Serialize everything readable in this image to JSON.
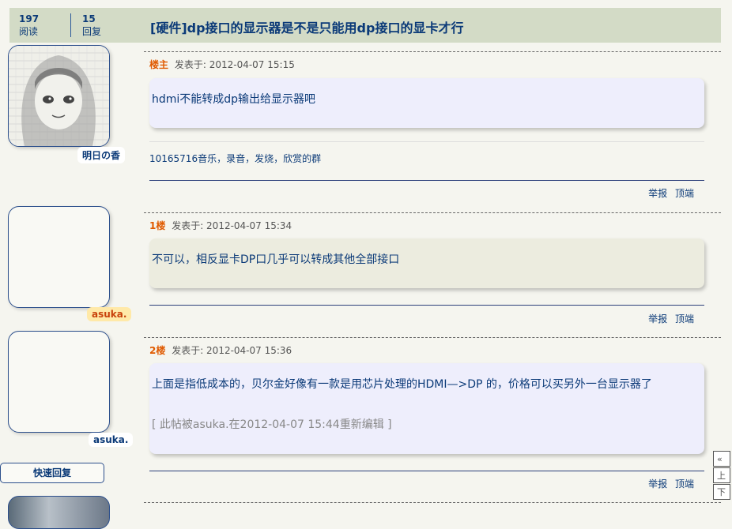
{
  "header": {
    "views_count": "197",
    "views_label": "阅读",
    "replies_count": "15",
    "replies_label": "回复",
    "title": "[硬件]dp接口的显示器是不是只能用dp接口的显卡才行"
  },
  "posts": [
    {
      "floor": "楼主",
      "posted_label": "发表于: 2012-04-07 15:15",
      "username": "明日の香",
      "content": "hdmi不能转成dp输出给显示器吧",
      "signature": "10165716音乐，录音，发烧，欣赏的群",
      "bubble_color": "#eeeefc"
    },
    {
      "floor": "1楼",
      "posted_label": "发表于: 2012-04-07 15:34",
      "username": "asuka.",
      "content": "不可以，相反显卡DP口几乎可以转成其他全部接口",
      "bubble_color": "#ececdf"
    },
    {
      "floor": "2楼",
      "posted_label": "发表于: 2012-04-07 15:36",
      "username": "asuka.",
      "content": "上面是指低成本的，贝尔金好像有一款是用芯片处理的HDMI—>DP 的，价格可以买另外一台显示器了",
      "edit_note": "[ 此帖被asuka.在2012-04-07 15:44重新编辑 ]",
      "bubble_color": "#eeeefc"
    }
  ],
  "actions": {
    "report": "举报",
    "top": "顶端"
  },
  "quick_reply": "快速回复",
  "side_nav": [
    "«",
    "上",
    "下"
  ]
}
